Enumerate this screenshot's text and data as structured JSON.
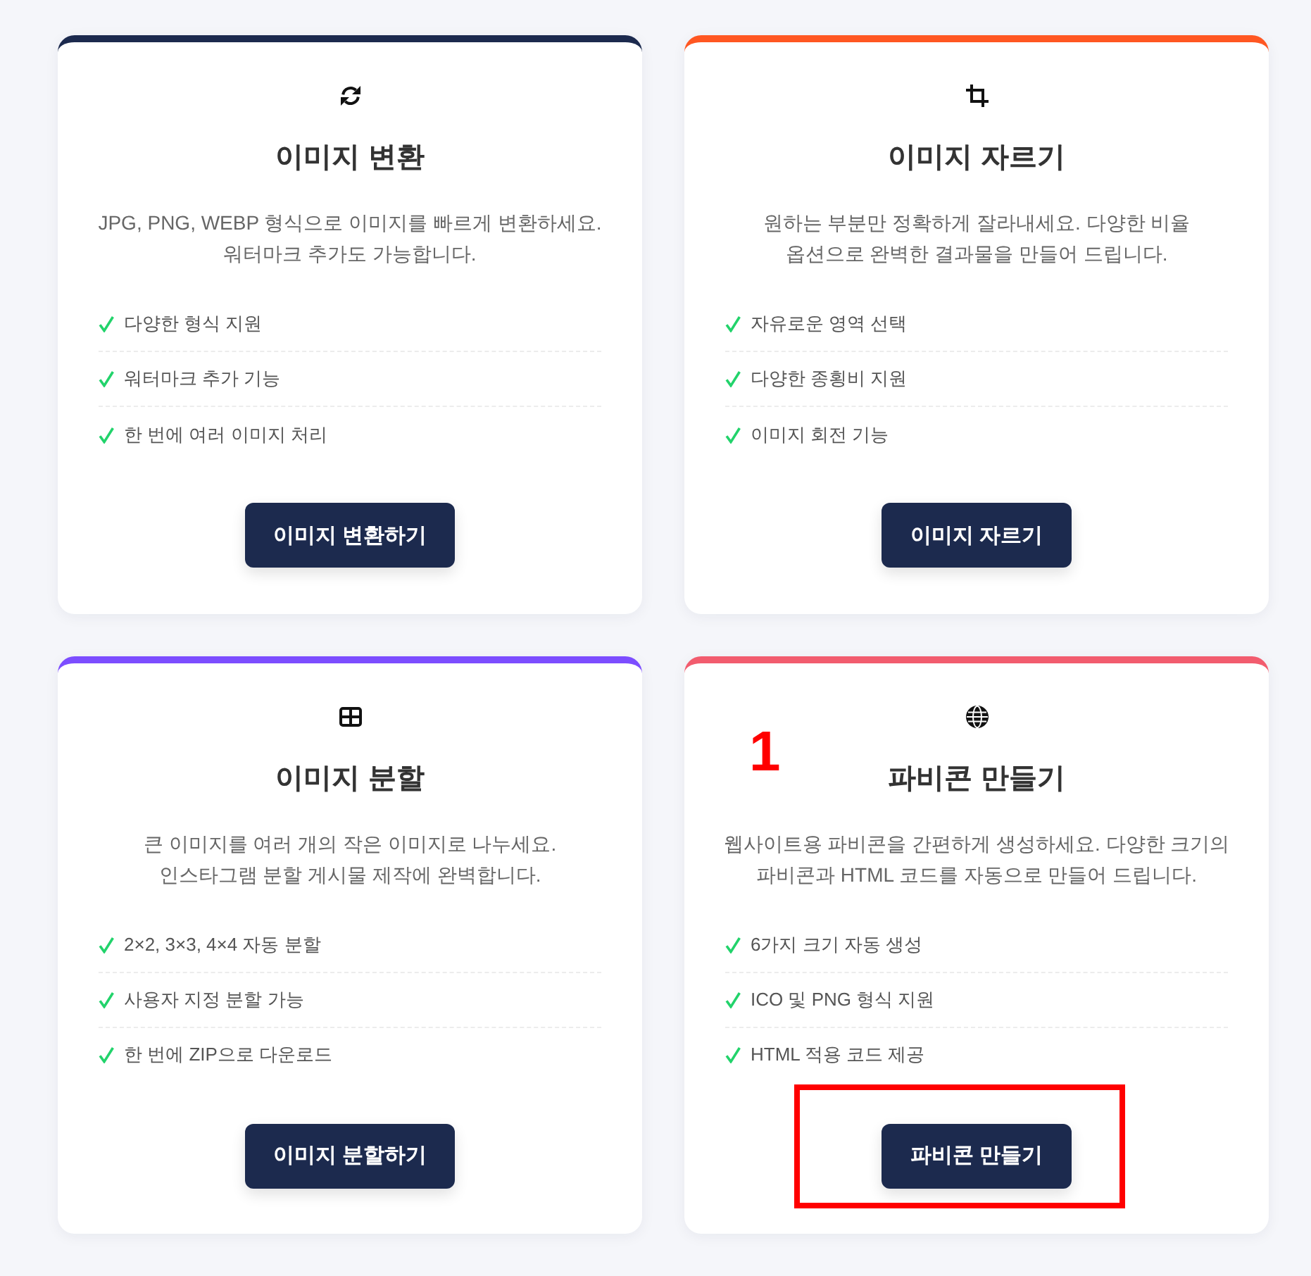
{
  "cards": [
    {
      "color": "#1c2a4e",
      "title": "이미지 변환",
      "description_lines": [
        "JPG, PNG, WEBP 형식으로 이미지를 빠르게 변환하세요.",
        "워터마크 추가도 가능합니다."
      ],
      "features": [
        "다양한 형식 지원",
        "워터마크 추가 기능",
        "한 번에 여러 이미지 처리"
      ],
      "button": "이미지 변환하기",
      "button_highlighted": false
    },
    {
      "color": "#ff5722",
      "title": "이미지 자르기",
      "description_lines": [
        "원하는 부분만 정확하게 잘라내세요. 다양한 비율",
        "옵션으로 완벽한 결과물을 만들어 드립니다."
      ],
      "features": [
        "자유로운 영역 선택",
        "다양한 종횡비 지원",
        "이미지 회전 기능"
      ],
      "button": "이미지 자르기",
      "button_highlighted": false
    },
    {
      "color": "#7c4dff",
      "title": "이미지 분할",
      "description_lines": [
        "큰 이미지를 여러 개의 작은 이미지로 나누세요.",
        "인스타그램 분할 게시물 제작에 완벽합니다."
      ],
      "features": [
        "2×2, 3×3, 4×4 자동 분할",
        "사용자 지정 분할 가능",
        "한 번에 ZIP으로 다운로드"
      ],
      "button": "이미지 분할하기",
      "button_highlighted": false
    },
    {
      "color": "#f25c6e",
      "title": "파비콘 만들기",
      "description_lines": [
        "웹사이트용 파비콘을 간편하게 생성하세요. 다양한 크기의",
        "파비콘과 HTML 코드를 자동으로 만들어 드립니다."
      ],
      "features": [
        "6가지 크기 자동 생성",
        "ICO 및 PNG 형식 지원",
        "HTML 적용 코드 제공"
      ],
      "button": "파비콘 만들기",
      "button_highlighted": true
    }
  ],
  "annotation_number": "1"
}
